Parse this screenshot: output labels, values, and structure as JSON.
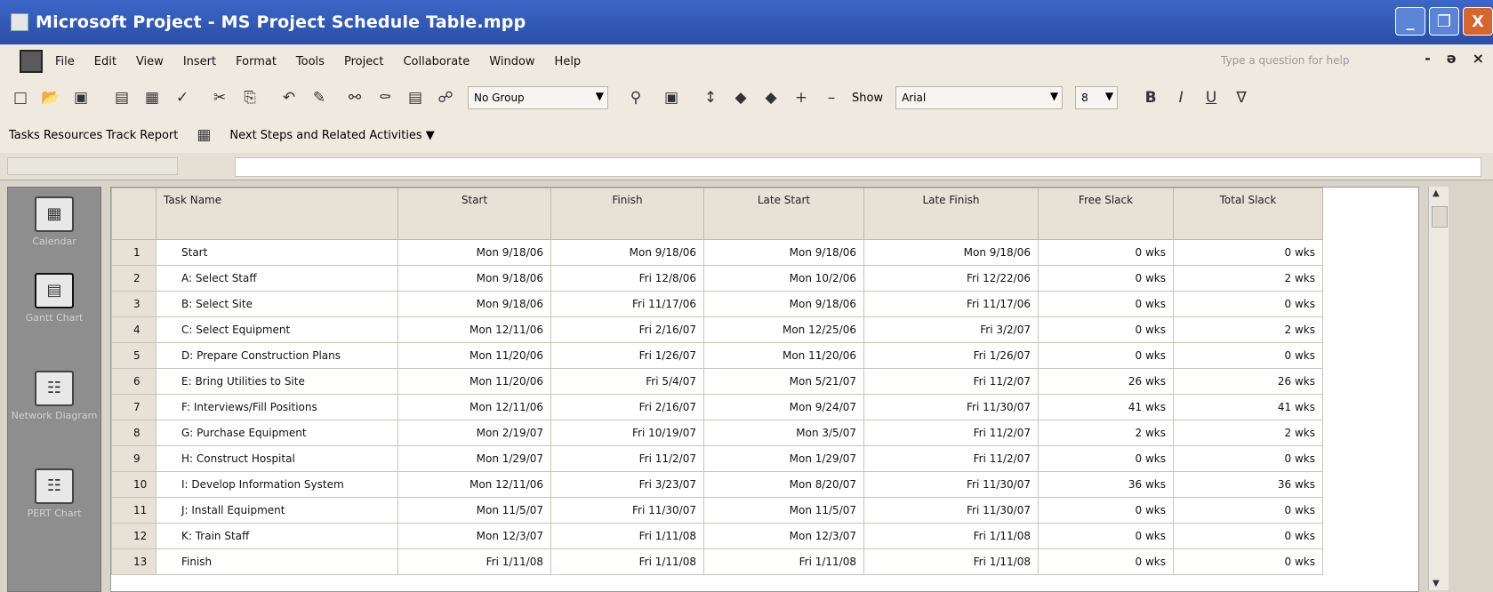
{
  "window": {
    "title": "Microsoft Project - MS Project Schedule Table.mpp",
    "controls": {
      "minimize": "_",
      "restore": "❐",
      "close": "X"
    }
  },
  "menubar": {
    "items": [
      "File",
      "Edit",
      "View",
      "Insert",
      "Format",
      "Tools",
      "Project",
      "Collaborate",
      "Window",
      "Help"
    ],
    "help_placeholder": "Type a question for help",
    "mdi": {
      "min": "-",
      "restore": "ə",
      "close": "×"
    }
  },
  "toolbar": {
    "group_combo": "No Group",
    "show_label": "Show",
    "font_combo": "Arial",
    "font_size": "8",
    "bold": "B",
    "italic": "I",
    "underline": "U",
    "filter_icon": "∇"
  },
  "guidebar": {
    "tabs": [
      "Tasks",
      "Resources",
      "Track",
      "Report"
    ],
    "next_steps": "Next Steps and Related Activities"
  },
  "viewbar": {
    "items": [
      {
        "label": "Calendar",
        "icon": "calendar-icon"
      },
      {
        "label": "Gantt Chart",
        "icon": "gantt-icon"
      },
      {
        "label": "Network Diagram",
        "icon": "network-icon"
      },
      {
        "label": "PERT Chart",
        "icon": "pert-icon"
      }
    ]
  },
  "table": {
    "columns": [
      "",
      "Task Name",
      "Start",
      "Finish",
      "Late Start",
      "Late Finish",
      "Free Slack",
      "Total Slack"
    ],
    "rows": [
      [
        "1",
        "Start",
        "Mon 9/18/06",
        "Mon 9/18/06",
        "Mon 9/18/06",
        "Mon 9/18/06",
        "0 wks",
        "0 wks"
      ],
      [
        "2",
        "A: Select Staff",
        "Mon 9/18/06",
        "Fri 12/8/06",
        "Mon 10/2/06",
        "Fri 12/22/06",
        "0 wks",
        "2 wks"
      ],
      [
        "3",
        "B: Select Site",
        "Mon 9/18/06",
        "Fri 11/17/06",
        "Mon 9/18/06",
        "Fri 11/17/06",
        "0 wks",
        "0 wks"
      ],
      [
        "4",
        "C: Select Equipment",
        "Mon 12/11/06",
        "Fri 2/16/07",
        "Mon 12/25/06",
        "Fri 3/2/07",
        "0 wks",
        "2 wks"
      ],
      [
        "5",
        "D: Prepare Construction Plans",
        "Mon 11/20/06",
        "Fri 1/26/07",
        "Mon 11/20/06",
        "Fri 1/26/07",
        "0 wks",
        "0 wks"
      ],
      [
        "6",
        "E: Bring Utilities to Site",
        "Mon 11/20/06",
        "Fri 5/4/07",
        "Mon 5/21/07",
        "Fri 11/2/07",
        "26 wks",
        "26 wks"
      ],
      [
        "7",
        "F: Interviews/Fill Positions",
        "Mon 12/11/06",
        "Fri 2/16/07",
        "Mon 9/24/07",
        "Fri 11/30/07",
        "41 wks",
        "41 wks"
      ],
      [
        "8",
        "G: Purchase Equipment",
        "Mon 2/19/07",
        "Fri 10/19/07",
        "Mon 3/5/07",
        "Fri 11/2/07",
        "2 wks",
        "2 wks"
      ],
      [
        "9",
        "H: Construct Hospital",
        "Mon 1/29/07",
        "Fri 11/2/07",
        "Mon 1/29/07",
        "Fri 11/2/07",
        "0 wks",
        "0 wks"
      ],
      [
        "10",
        "I: Develop Information System",
        "Mon 12/11/06",
        "Fri 3/23/07",
        "Mon 8/20/07",
        "Fri 11/30/07",
        "36 wks",
        "36 wks"
      ],
      [
        "11",
        "J: Install Equipment",
        "Mon 11/5/07",
        "Fri 11/30/07",
        "Mon 11/5/07",
        "Fri 11/30/07",
        "0 wks",
        "0 wks"
      ],
      [
        "12",
        "K: Train Staff",
        "Mon 12/3/07",
        "Fri 1/11/08",
        "Mon 12/3/07",
        "Fri 1/11/08",
        "0 wks",
        "0 wks"
      ],
      [
        "13",
        "Finish",
        "Fri 1/11/08",
        "Fri 1/11/08",
        "Fri 1/11/08",
        "Fri 1/11/08",
        "0 wks",
        "0 wks"
      ]
    ]
  }
}
